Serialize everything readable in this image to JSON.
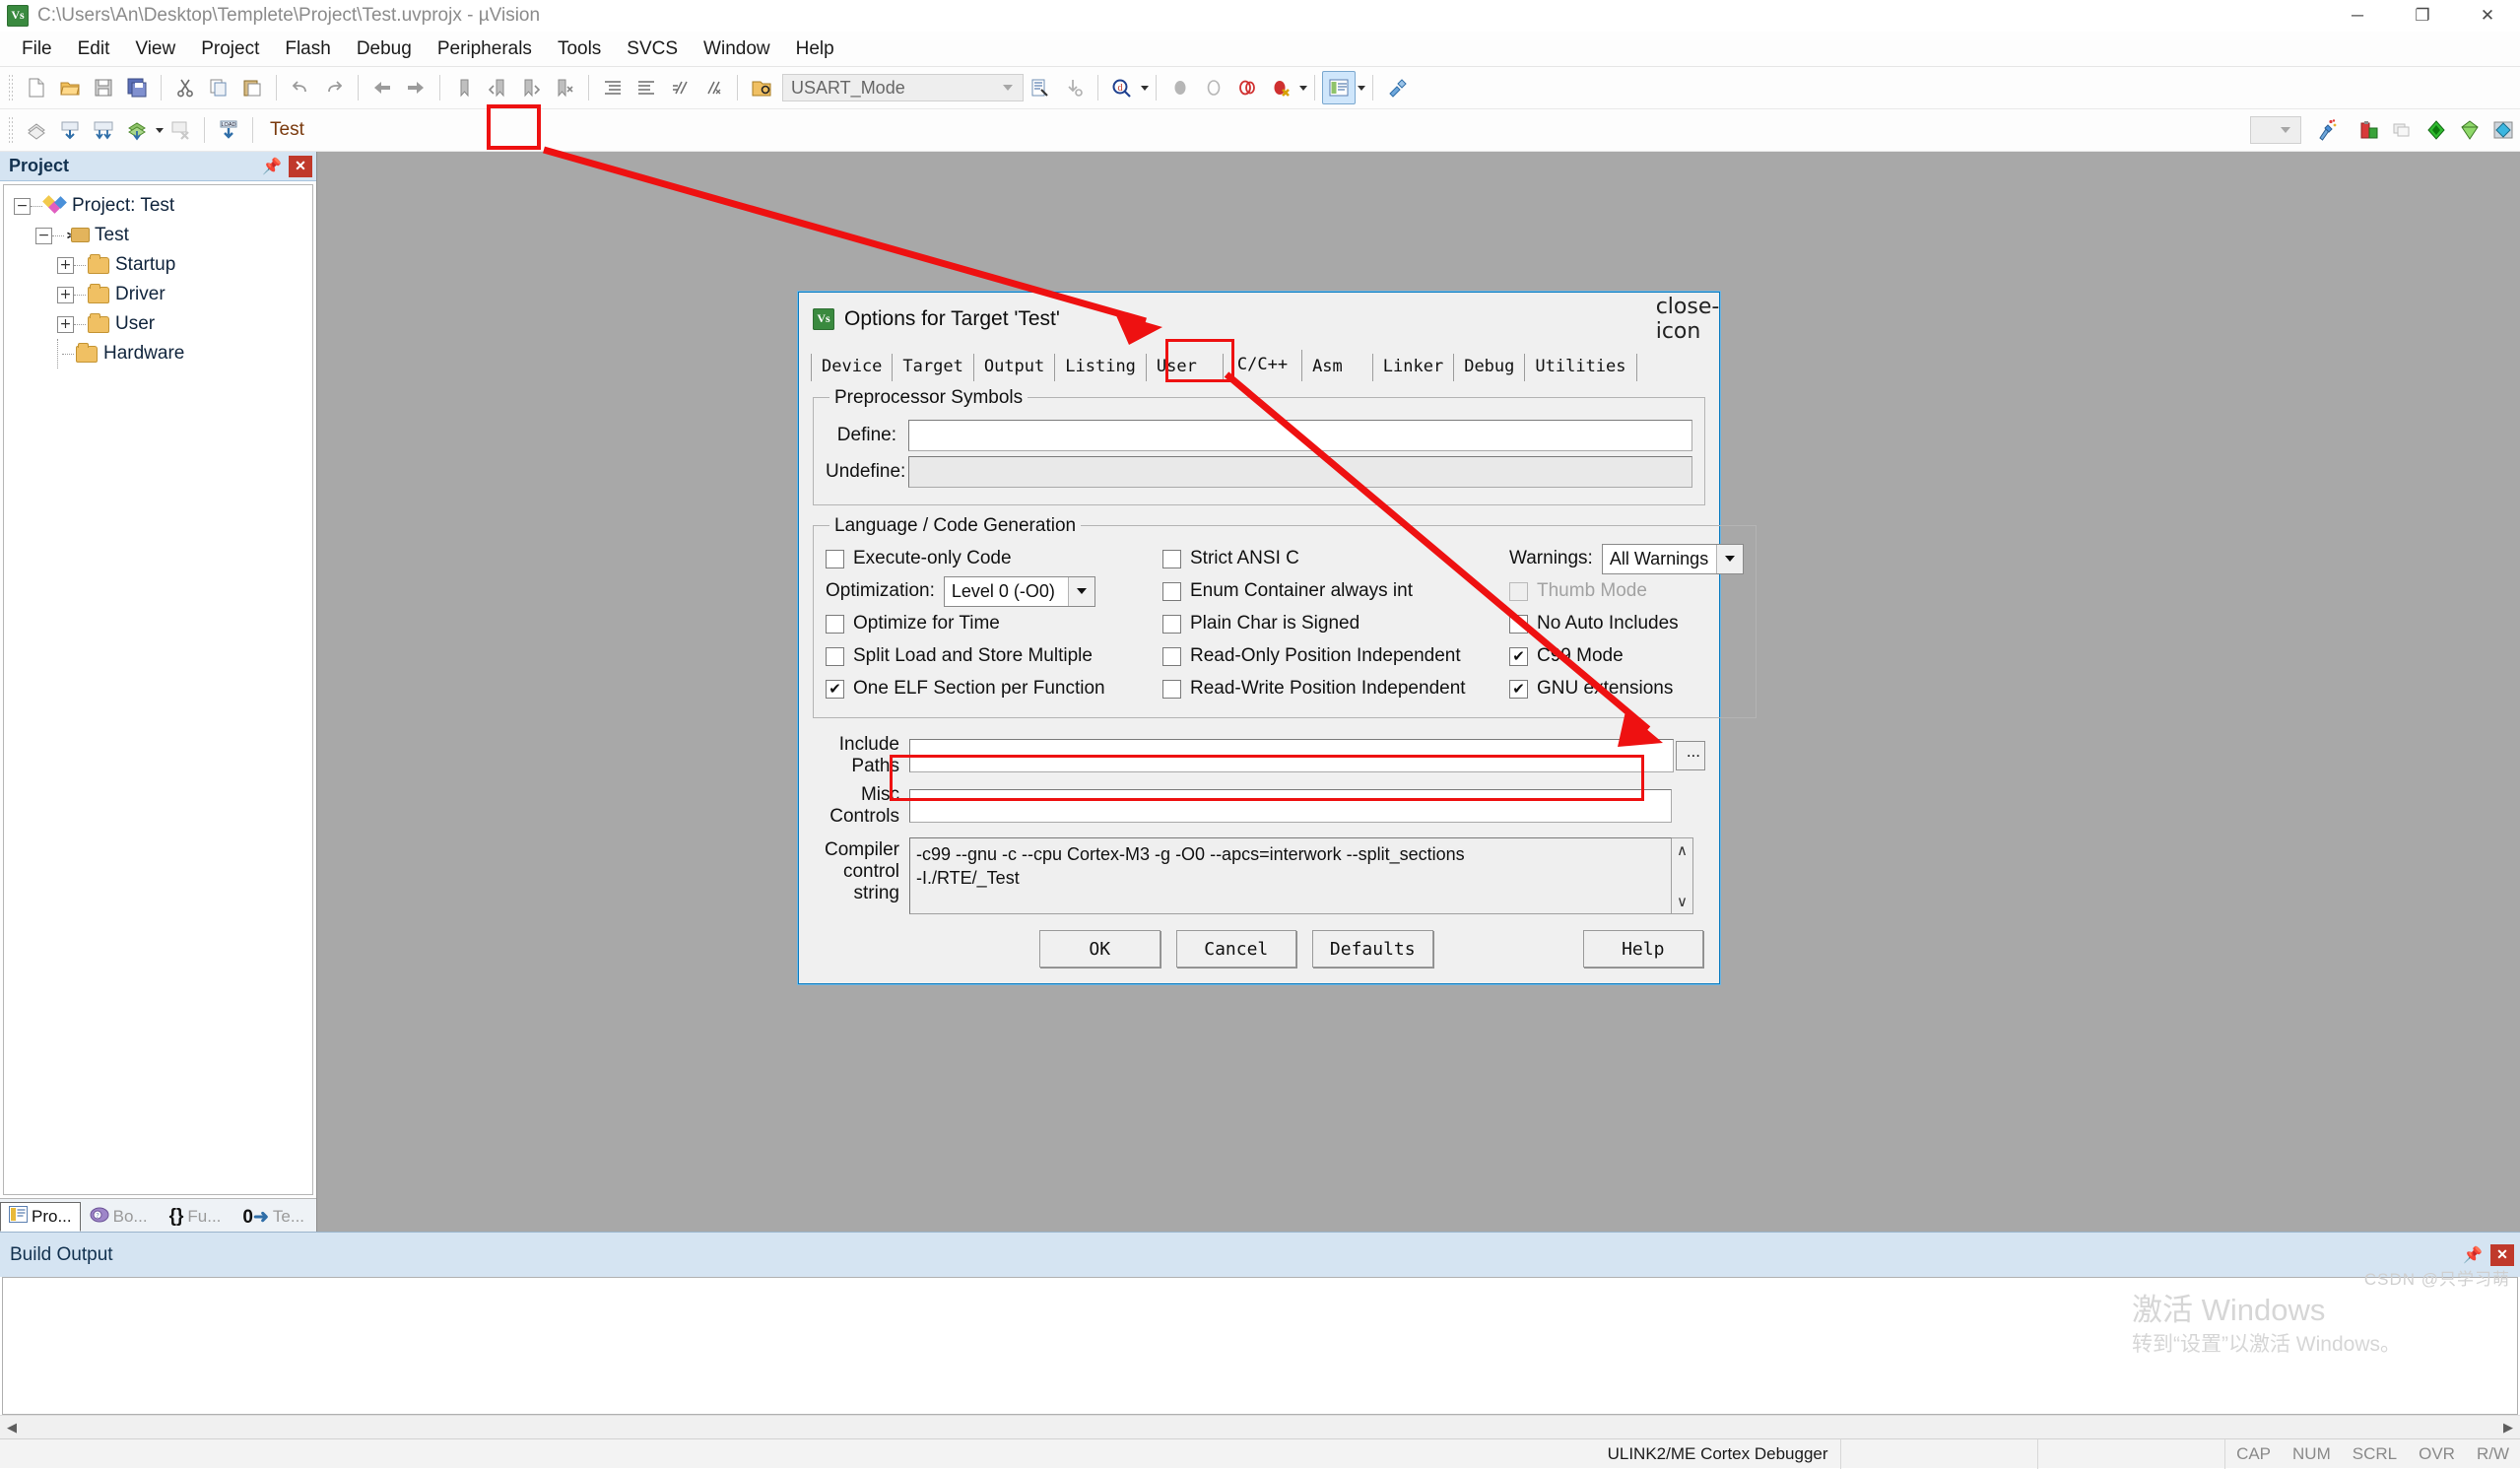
{
  "window": {
    "title": "C:\\Users\\An\\Desktop\\Templete\\Project\\Test.uvprojx - µVision",
    "app_icon": "keil-uvision-icon",
    "minimize": "─",
    "maximize": "❐",
    "close": "✕"
  },
  "menu": {
    "items": [
      "File",
      "Edit",
      "View",
      "Project",
      "Flash",
      "Debug",
      "Peripherals",
      "Tools",
      "SVCS",
      "Window",
      "Help"
    ]
  },
  "toolbar_main": {
    "icons": [
      "new-file-icon",
      "open-file-icon",
      "save-icon",
      "save-all-icon",
      "cut-icon",
      "copy-icon",
      "paste-icon",
      "undo-icon",
      "redo-icon",
      "navigate-back-icon",
      "navigate-forward-icon",
      "bookmark-toggle-icon",
      "bookmark-prev-icon",
      "bookmark-next-icon",
      "bookmark-clear-icon",
      "indent-icon",
      "outdent-icon",
      "comment-icon",
      "uncomment-icon",
      "open-project-icon"
    ],
    "function_combo_value": "USART_Mode",
    "after_icons": [
      "browse-info-icon",
      "goto-definition-icon",
      "find-in-files-icon",
      "debug-start-icon",
      "debug-stop-icon",
      "insert-breakpoint-icon",
      "kill-breakpoints-icon",
      "project-window-icon",
      "config-wizard-icon"
    ]
  },
  "toolbar_build": {
    "icons": [
      "translate-icon",
      "build-icon",
      "rebuild-icon",
      "batch-build-icon",
      "stop-build-icon",
      "download-icon"
    ],
    "target_name": "Test",
    "target_dropdown": "chevron-down-icon",
    "options_icon": "options-for-target-icon",
    "right_icons": [
      "manage-project-items-icon",
      "multi-project-icon",
      "pack-installer-icon",
      "manage-rte-icon",
      "pack-manage-icon"
    ]
  },
  "project_panel": {
    "title": "Project",
    "pin_icon": "pin-icon",
    "close_icon": "close-icon",
    "tree": [
      {
        "label": "Project: Test",
        "expander": "−",
        "indent": 0,
        "icon": "project-icon"
      },
      {
        "label": "Test",
        "expander": "−",
        "indent": 1,
        "icon": "target-icon"
      },
      {
        "label": "Startup",
        "expander": "+",
        "indent": 2,
        "icon": "folder-icon"
      },
      {
        "label": "Driver",
        "expander": "+",
        "indent": 2,
        "icon": "folder-icon"
      },
      {
        "label": "User",
        "expander": "+",
        "indent": 2,
        "icon": "folder-icon"
      },
      {
        "label": "Hardware",
        "expander": "",
        "indent": 2,
        "icon": "folder-icon"
      }
    ],
    "tabs": [
      {
        "label": "Pro...",
        "icon": "project-tab-icon",
        "active": true
      },
      {
        "label": "Bo...",
        "icon": "books-tab-icon",
        "active": false
      },
      {
        "label": "Fu...",
        "icon": "functions-tab-icon",
        "active": false
      },
      {
        "label": "Te...",
        "icon": "templates-tab-icon",
        "active": false
      }
    ]
  },
  "build_output": {
    "title": "Build Output",
    "pin_icon": "pin-icon",
    "close_icon": "close-icon",
    "text": ""
  },
  "watermark": {
    "line1": "激活 Windows",
    "line2": "转到“设置”以激活 Windows。"
  },
  "status_bar": {
    "message": "",
    "debugger": "ULINK2/ME Cortex Debugger",
    "keys": [
      "CAP",
      "NUM",
      "SCRL",
      "OVR",
      "R/W"
    ],
    "csdn": "CSDN @只学习萌"
  },
  "dialog": {
    "title": "Options for Target 'Test'",
    "icon": "keil-uvision-icon",
    "close_icon": "close-icon",
    "tabs": [
      {
        "label": "Device",
        "selected": false
      },
      {
        "label": "Target",
        "selected": false
      },
      {
        "label": "Output",
        "selected": false
      },
      {
        "label": "Listing",
        "selected": false
      },
      {
        "label": "User",
        "selected": false
      },
      {
        "label": "C/C++",
        "selected": true
      },
      {
        "label": "Asm",
        "selected": false
      },
      {
        "label": "Linker",
        "selected": false
      },
      {
        "label": "Debug",
        "selected": false
      },
      {
        "label": "Utilities",
        "selected": false
      }
    ],
    "preprocessor": {
      "legend": "Preprocessor Symbols",
      "define_label": "Define:",
      "define_value": "",
      "undefine_label": "Undefine:",
      "undefine_value": ""
    },
    "language": {
      "legend": "Language / Code Generation",
      "col1": [
        {
          "label": "Execute-only Code",
          "checked": false,
          "disabled": false
        },
        {
          "label": "Optimize for Time",
          "checked": false,
          "disabled": false
        },
        {
          "label": "Split Load and Store Multiple",
          "checked": false,
          "disabled": false
        },
        {
          "label": "One ELF Section per Function",
          "checked": true,
          "disabled": false
        }
      ],
      "optimization_label": "Optimization:",
      "optimization_value": "Level 0 (-O0)",
      "col2": [
        {
          "label": "Strict ANSI C",
          "checked": false,
          "disabled": false
        },
        {
          "label": "Enum Container always int",
          "checked": false,
          "disabled": false
        },
        {
          "label": "Plain Char is Signed",
          "checked": false,
          "disabled": false
        },
        {
          "label": "Read-Only Position Independent",
          "checked": false,
          "disabled": false
        },
        {
          "label": "Read-Write Position Independent",
          "checked": false,
          "disabled": false
        }
      ],
      "warnings_label": "Warnings:",
      "warnings_value": "All Warnings",
      "col3": [
        {
          "label": "Thumb Mode",
          "checked": false,
          "disabled": true
        },
        {
          "label": "No Auto Includes",
          "checked": false,
          "disabled": false
        },
        {
          "label": "C99 Mode",
          "checked": true,
          "disabled": false
        },
        {
          "label": "GNU extensions",
          "checked": true,
          "disabled": false
        }
      ]
    },
    "include_paths": {
      "label_line1": "Include",
      "label_line2": "Paths",
      "value": "",
      "browse_button": "..."
    },
    "misc_controls": {
      "label_line1": "Misc",
      "label_line2": "Controls",
      "value": ""
    },
    "compiler_control": {
      "label_line1": "Compiler",
      "label_line2": "control",
      "label_line3": "string",
      "value": "-c99 --gnu -c --cpu Cortex-M3 -g -O0 --apcs=interwork --split_sections\n-I./RTE/_Test",
      "scroll_up": "∧",
      "scroll_down": "∨"
    },
    "buttons": {
      "ok": "OK",
      "cancel": "Cancel",
      "defaults": "Defaults",
      "help": "Help"
    }
  },
  "annotations": {
    "highlight_color": "#ee1111",
    "boxes": [
      "options-for-target-toolbar-button",
      "cpp-tab",
      "include-paths-field"
    ],
    "arrows": [
      "toolbar-button-to-dialog-titlebar",
      "cpp-tab-to-include-paths"
    ]
  }
}
